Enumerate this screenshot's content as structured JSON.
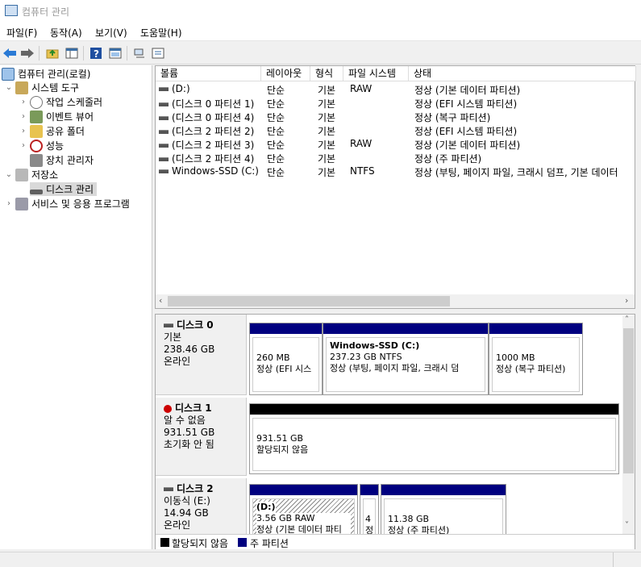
{
  "window": {
    "title": "컴퓨터 관리"
  },
  "menu": [
    "파일(F)",
    "동작(A)",
    "보기(V)",
    "도움말(H)"
  ],
  "tree": {
    "root": "컴퓨터 관리(로컬)",
    "system_tools": "시스템 도구",
    "task_scheduler": "작업 스케줄러",
    "event_viewer": "이벤트 뷰어",
    "shared_folders": "공유 폴더",
    "performance": "성능",
    "device_manager": "장치 관리자",
    "storage": "저장소",
    "disk_management": "디스크 관리",
    "services": "서비스 및 응용 프로그램"
  },
  "volumes": {
    "columns": [
      "볼륨",
      "레이아웃",
      "형식",
      "파일 시스템",
      "상태"
    ],
    "rows": [
      {
        "name": "(D:)",
        "layout": "단순",
        "type": "기본",
        "fs": "RAW",
        "status": "정상 (기본 데이터 파티션)"
      },
      {
        "name": "(디스크 0 파티션 1)",
        "layout": "단순",
        "type": "기본",
        "fs": "",
        "status": "정상 (EFI 시스템 파티션)"
      },
      {
        "name": "(디스크 0 파티션 4)",
        "layout": "단순",
        "type": "기본",
        "fs": "",
        "status": "정상 (복구 파티션)"
      },
      {
        "name": "(디스크 2 파티션 2)",
        "layout": "단순",
        "type": "기본",
        "fs": "",
        "status": "정상 (EFI 시스템 파티션)"
      },
      {
        "name": "(디스크 2 파티션 3)",
        "layout": "단순",
        "type": "기본",
        "fs": "RAW",
        "status": "정상 (기본 데이터 파티션)"
      },
      {
        "name": "(디스크 2 파티션 4)",
        "layout": "단순",
        "type": "기본",
        "fs": "",
        "status": "정상 (주 파티션)"
      },
      {
        "name": "Windows-SSD (C:)",
        "layout": "단순",
        "type": "기본",
        "fs": "NTFS",
        "status": "정상 (부팅, 페이지 파일, 크래시 덤프, 기본 데이터"
      }
    ]
  },
  "disks": {
    "d0": {
      "name": "디스크 0",
      "type": "기본",
      "size": "238.46 GB",
      "state": "온라인",
      "p1": {
        "size": "260 MB",
        "status": "정상 (EFI 시스"
      },
      "p2": {
        "title": "Windows-SSD  (C:)",
        "size": "237.23 GB NTFS",
        "status": "정상 (부팅, 페이지 파일, 크래시 덤"
      },
      "p3": {
        "size": "1000 MB",
        "status": "정상 (복구 파티션)"
      }
    },
    "d1": {
      "name": "디스크 1",
      "type": "알 수 없음",
      "size": "931.51 GB",
      "state": "초기화 안 됨",
      "p1": {
        "size": "931.51 GB",
        "status": "할당되지 않음"
      }
    },
    "d2": {
      "name": "디스크 2",
      "type": "이동식 (E:)",
      "size": "14.94 GB",
      "state": "온라인",
      "p1": {
        "title": "(D:)",
        "size": "3.56 GB RAW",
        "status": "정상 (기본 데이터 파티"
      },
      "p2": {
        "size": "4",
        "status": "정"
      },
      "p3": {
        "size": "11.38 GB",
        "status": "정상 (주 파티션)"
      }
    }
  },
  "legend": {
    "unallocated": "할당되지 않음",
    "primary": "주 파티션"
  },
  "colors": {
    "primary": "#00007f",
    "unallocated": "#000000"
  }
}
